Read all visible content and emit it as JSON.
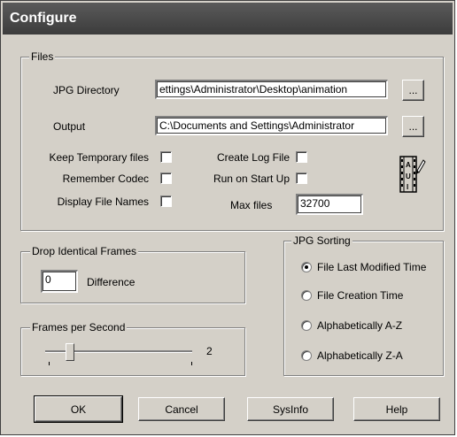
{
  "window": {
    "title": "Configure"
  },
  "files": {
    "legend": "Files",
    "jpg_directory_label": "JPG Directory",
    "jpg_directory_value": "ettings\\Administrator\\Desktop\\animation",
    "output_label": "Output",
    "output_value": "C:\\Documents and Settings\\Administrator",
    "browse_label": "...",
    "options": {
      "keep_temporary": {
        "label": "Keep Temporary files",
        "checked": false
      },
      "remember_codec": {
        "label": "Remember Codec",
        "checked": false
      },
      "display_file_names": {
        "label": "Display File Names",
        "checked": false
      },
      "create_log_file": {
        "label": "Create Log File",
        "checked": false
      },
      "run_on_startup": {
        "label": "Run on Start Up",
        "checked": false
      }
    },
    "max_files_label": "Max files",
    "max_files_value": "32700",
    "icon": "film-pencil-icon"
  },
  "drop_frames": {
    "legend": "Drop Identical Frames",
    "value": "0",
    "label": "Difference"
  },
  "fps": {
    "legend": "Frames per Second",
    "value": "2",
    "slider_position": 0.15
  },
  "sorting": {
    "legend": "JPG Sorting",
    "options": [
      {
        "label": "File Last Modified Time",
        "checked": true
      },
      {
        "label": "File Creation Time",
        "checked": false
      },
      {
        "label": "Alphabetically A-Z",
        "checked": false
      },
      {
        "label": "Alphabetically Z-A",
        "checked": false
      }
    ]
  },
  "buttons": {
    "ok": "OK",
    "cancel": "Cancel",
    "sysinfo": "SysInfo",
    "help": "Help"
  },
  "colors": {
    "dialog_bg": "#d4d0c8",
    "titlebar": "#4a4a4a"
  }
}
